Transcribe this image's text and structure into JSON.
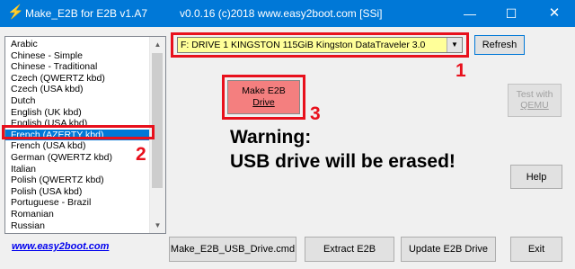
{
  "window": {
    "title": "Make_E2B for E2B v1.A7",
    "subtitle": "v0.0.16  (c)2018 www.easy2boot.com [SSi]",
    "min_glyph": "—",
    "max_glyph": "☐",
    "close_glyph": "✕"
  },
  "languages": [
    "Arabic",
    "Chinese - Simple",
    "Chinese - Traditional",
    "Czech   (QWERTZ kbd)",
    "Czech   (USA kbd)",
    "Dutch",
    "English  (UK kbd)",
    "English  (USA kbd)",
    "French  (AZERTY kbd)",
    "French  (USA kbd)",
    "German  (QWERTZ kbd)",
    "Italian",
    "Polish  (QWERTZ kbd)",
    "Polish  (USA kbd)",
    "Portuguese - Brazil",
    "Romanian",
    "Russian"
  ],
  "selected_language_index": 8,
  "drive": {
    "value": "F: DRIVE 1  KINGSTON     115GiB Kingston DataTraveler 3.0"
  },
  "buttons": {
    "refresh": "Refresh",
    "make_line1": "Make E2B",
    "make_line2": "Drive",
    "test_line1": "Test with",
    "test_line2": "QEMU",
    "help": "Help",
    "make_cmd": "Make_E2B_USB_Drive.cmd",
    "extract": "Extract E2B",
    "update": "Update E2B Drive",
    "exit": "Exit"
  },
  "warning": {
    "line1": "Warning:",
    "line2": "USB drive will be erased!"
  },
  "website": "www.easy2boot.com",
  "annotations": {
    "one": "1",
    "two": "2",
    "three": "3"
  },
  "colors": {
    "titlebar": "#0078d7",
    "highlight_red": "#e8101c",
    "drive_bg": "#ffff99",
    "make_button": "#f47f7f",
    "selection": "#0078d7"
  }
}
